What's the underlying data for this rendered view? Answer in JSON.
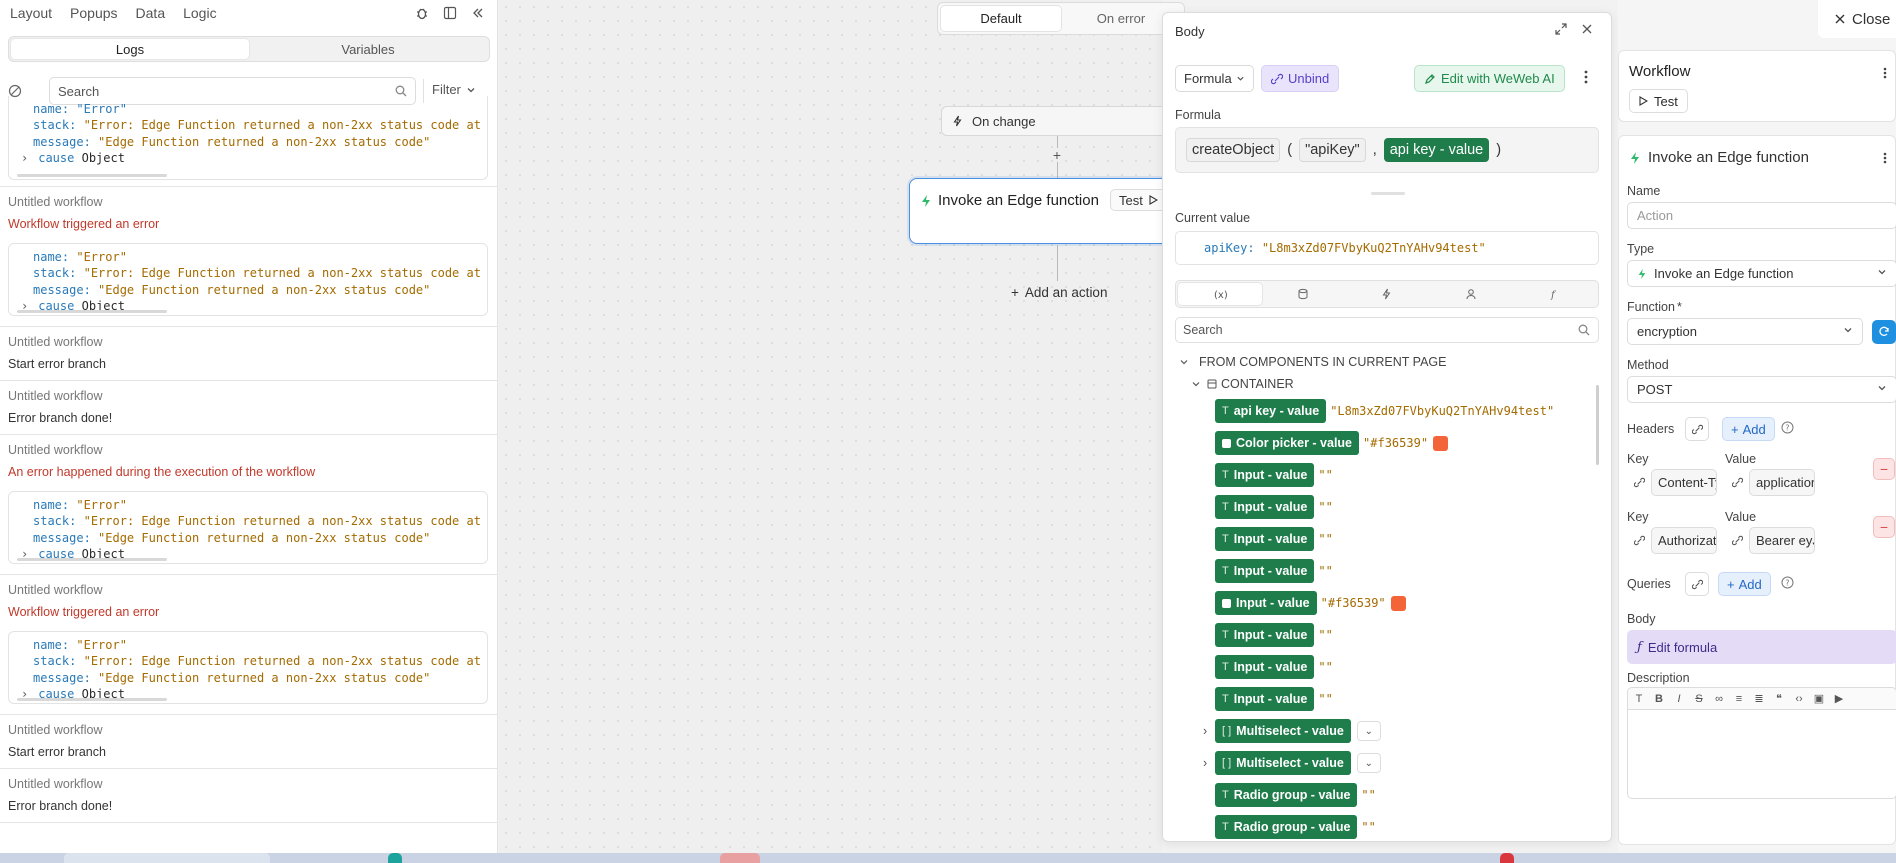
{
  "topnav": {
    "items": [
      "Layout",
      "Popups",
      "Data",
      "Logic"
    ]
  },
  "logtabs": {
    "logs": "Logs",
    "variables": "Variables"
  },
  "logsearch": {
    "placeholder": "Search",
    "filter": "Filter"
  },
  "logs": {
    "top_partial": {
      "name_line": "name: \"Error\"",
      "stack_key": "stack:",
      "stack_val": "\"Error: Edge Function returned a non-2xx status code at",
      "msg_key": "message:",
      "msg_val": "\"Edge Function returned a non-2xx status code\"",
      "cause_key": "cause",
      "cause_val": "Object"
    },
    "entries": [
      {
        "wf": "Untitled workflow",
        "msg": "Workflow triggered an error",
        "error": true,
        "box": true
      },
      {
        "wf": "Untitled workflow",
        "msg": "Start error branch",
        "error": false,
        "box": false
      },
      {
        "wf": "Untitled workflow",
        "msg": "Error branch done!",
        "error": false,
        "box": false
      },
      {
        "wf": "Untitled workflow",
        "msg": "An error happened during the execution of the workflow",
        "error": true,
        "box": true
      },
      {
        "wf": "Untitled workflow",
        "msg": "Workflow triggered an error",
        "error": true,
        "box": true
      },
      {
        "wf": "Untitled workflow",
        "msg": "Start error branch",
        "error": false,
        "box": false
      },
      {
        "wf": "Untitled workflow",
        "msg": "Error branch done!",
        "error": false,
        "box": false
      }
    ],
    "errbox": {
      "name_key": "name:",
      "name_val": "\"Error\"",
      "stack_key": "stack:",
      "stack_val": "\"Error: Edge Function returned a non-2xx status code at",
      "msg_key": "message:",
      "msg_val": "\"Edge Function returned a non-2xx status code\"",
      "cause_key": "cause",
      "cause_val": "Object"
    }
  },
  "canvas": {
    "branch_default": "Default",
    "branch_onerror": "On error",
    "trigger": "On change",
    "plus": "+",
    "action_title": "Invoke an Edge function",
    "action_test": "Test",
    "add_action": "Add an action"
  },
  "bodypanel": {
    "title": "Body",
    "mode": "Formula",
    "unbind": "Unbind",
    "ai": "Edit with WeWeb AI",
    "formula_label": "Formula",
    "formula_tokens": {
      "fn": "createObject",
      "open": "(",
      "key": "\"apiKey\"",
      "comma": ",",
      "var": "api key - value",
      "close": ")"
    },
    "current_value_label": "Current value",
    "current_value_key": "apiKey:",
    "current_value_val": "\"L8m3xZd07FVbyKuQ2TnYAHv94test\"",
    "search_placeholder": "Search",
    "tree_section": "FROM COMPONENTS IN CURRENT PAGE",
    "tree_container": "CONTAINER",
    "variables": [
      {
        "label": "api key - value",
        "kind": "T",
        "value": "\"L8m3xZd07FVbyKuQ2TnYAHv94test\"",
        "swatch": ""
      },
      {
        "label": "Color picker - value",
        "kind": "sq",
        "value": "\"#f36539\"",
        "swatch": "#f36539"
      },
      {
        "label": "Input - value",
        "kind": "T",
        "value": "\"\"",
        "swatch": ""
      },
      {
        "label": "Input - value",
        "kind": "T",
        "value": "\"\"",
        "swatch": ""
      },
      {
        "label": "Input - value",
        "kind": "T",
        "value": "\"\"",
        "swatch": ""
      },
      {
        "label": "Input - value",
        "kind": "T",
        "value": "\"\"",
        "swatch": ""
      },
      {
        "label": "Input - value",
        "kind": "sq",
        "value": "\"#f36539\"",
        "swatch": "#f36539"
      },
      {
        "label": "Input - value",
        "kind": "T",
        "value": "\"\"",
        "swatch": ""
      },
      {
        "label": "Input - value",
        "kind": "T",
        "value": "\"\"",
        "swatch": ""
      },
      {
        "label": "Input - value",
        "kind": "T",
        "value": "\"\"",
        "swatch": ""
      },
      {
        "label": "Multiselect - value",
        "kind": "arr",
        "value": "",
        "swatch": "",
        "expandable": true
      },
      {
        "label": "Multiselect - value",
        "kind": "arr",
        "value": "",
        "swatch": "",
        "expandable": true
      },
      {
        "label": "Radio group - value",
        "kind": "T",
        "value": "\"\"",
        "swatch": ""
      },
      {
        "label": "Radio group - value",
        "kind": "T",
        "value": "\"\"",
        "swatch": ""
      }
    ]
  },
  "rightpanel": {
    "close": "Close",
    "workflow_title": "Workflow",
    "workflow_test": "Test",
    "action_title": "Invoke an Edge function",
    "name_label": "Name",
    "name_placeholder": "Action",
    "type_label": "Type",
    "type_value": "Invoke an Edge function",
    "function_label": "Function",
    "function_required": "*",
    "function_value": "encryption",
    "method_label": "Method",
    "method_value": "POST",
    "headers_label": "Headers",
    "add_label": "Add",
    "key_label": "Key",
    "value_label": "Value",
    "headers": [
      {
        "key": "Content-Typ",
        "value": "application/"
      },
      {
        "key": "Authorizatic",
        "value": "Bearer eyJh"
      }
    ],
    "queries_label": "Queries",
    "body_label": "Body",
    "edit_formula": "Edit formula",
    "description_label": "Description"
  },
  "colors": {
    "accent_green": "#1f7d4c",
    "swatch": "#f36539",
    "link_blue": "#2468c5",
    "error_red": "#c0392b"
  }
}
